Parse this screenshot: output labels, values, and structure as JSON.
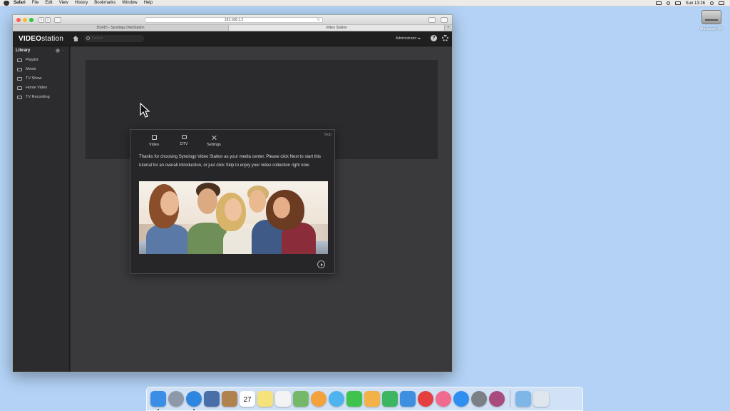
{
  "menubar": {
    "app_name": "Safari",
    "items": [
      "File",
      "Edit",
      "View",
      "History",
      "Bookmarks",
      "Window",
      "Help"
    ],
    "clock": "Sun 13:26"
  },
  "desktop": {
    "drive_label": "Macintosh HD"
  },
  "browser": {
    "url": "192.168.1.2",
    "tabs": [
      {
        "label": "DS415 - Synology DiskStation",
        "active": false
      },
      {
        "label": "Video Station",
        "active": true
      }
    ]
  },
  "app": {
    "logo_bold": "VIDEO",
    "logo_rest": "station",
    "search_placeholder": "Search",
    "user_menu": "Administrator",
    "help_glyph": "?"
  },
  "sidebar": {
    "heading": "Library",
    "add_glyph": "+",
    "more_glyph": "⋯",
    "items": [
      {
        "label": "Playlist",
        "icon": "playlist-icon"
      },
      {
        "label": "Movie",
        "icon": "movie-icon"
      },
      {
        "label": "TV Show",
        "icon": "tv-show-icon"
      },
      {
        "label": "Home Video",
        "icon": "home-video-icon"
      },
      {
        "label": "TV Recording",
        "icon": "tv-recording-icon"
      }
    ]
  },
  "dialog": {
    "skip_label": "Skip",
    "tabs": [
      {
        "label": "Video",
        "icon": "video-icon"
      },
      {
        "label": "DTV",
        "icon": "dtv-icon"
      },
      {
        "label": "Settings",
        "icon": "settings-icon"
      }
    ],
    "text": "Thanks for choosing Synology Video Station as your media center. Please click Next to start this tutorial for an overall introduction, or just click Skip to enjoy your video collection right now."
  },
  "dock": {
    "calendar_day": "27",
    "apps": [
      {
        "name": "finder-icon",
        "color": "#3a8ee6"
      },
      {
        "name": "launchpad-icon",
        "color": "#8d99a8"
      },
      {
        "name": "safari-icon",
        "color": "#2f86e0"
      },
      {
        "name": "photo-viewer-icon",
        "color": "#4a6ea8"
      },
      {
        "name": "contacts-icon",
        "color": "#b0824e"
      },
      {
        "name": "calendar-icon",
        "color": "#ffffff"
      },
      {
        "name": "notes-icon",
        "color": "#f6e27a"
      },
      {
        "name": "reminders-icon",
        "color": "#f3f3f3"
      },
      {
        "name": "maps-icon",
        "color": "#76b86a"
      },
      {
        "name": "photos-icon",
        "color": "#f4a23c"
      },
      {
        "name": "messages-icon",
        "color": "#4fb3f0"
      },
      {
        "name": "facetime-icon",
        "color": "#3fc34c"
      },
      {
        "name": "pages-icon",
        "color": "#f3b248"
      },
      {
        "name": "numbers-icon",
        "color": "#3db662"
      },
      {
        "name": "keynote-icon",
        "color": "#3d8fe0"
      },
      {
        "name": "news-icon",
        "color": "#e5403f"
      },
      {
        "name": "itunes-icon",
        "color": "#f26a8f"
      },
      {
        "name": "app-store-icon",
        "color": "#2e8ff0"
      },
      {
        "name": "system-preferences-icon",
        "color": "#7b7f86"
      },
      {
        "name": "photo-booth-icon",
        "color": "#a84c7d"
      }
    ],
    "extras": [
      {
        "name": "downloads-folder-icon",
        "color": "#7fb6e8"
      },
      {
        "name": "trash-icon",
        "color": "#dfe6ee"
      }
    ]
  }
}
